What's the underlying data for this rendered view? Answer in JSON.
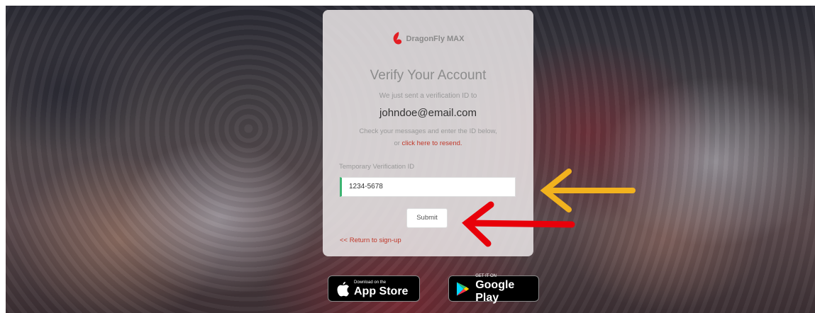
{
  "brand": {
    "name": "DragonFly MAX",
    "logo_icon": "dragonfly-swirl-icon",
    "accent": "#e31e24"
  },
  "card": {
    "title": "Verify Your Account",
    "sent_text": "We just sent a verification ID to",
    "email": "johndoe@email.com",
    "instructions": "Check your messages and enter the ID below,",
    "or_text": "or",
    "resend_link": "click here to resend.",
    "field_label": "Temporary Verification ID",
    "field_value": "1234-5678",
    "submit_label": "Submit",
    "return_link": "<< Return to sign-up"
  },
  "stores": {
    "apple": {
      "small": "Download on the",
      "big": "App Store",
      "icon": "apple-icon"
    },
    "google": {
      "small": "GET IT ON",
      "big": "Google Play",
      "icon": "google-play-icon"
    }
  },
  "annotations": {
    "yellow_arrow": {
      "color": "#f2b21e",
      "icon": "arrow-left-icon"
    },
    "red_arrow": {
      "color": "#e8000a",
      "icon": "arrow-left-icon"
    }
  }
}
